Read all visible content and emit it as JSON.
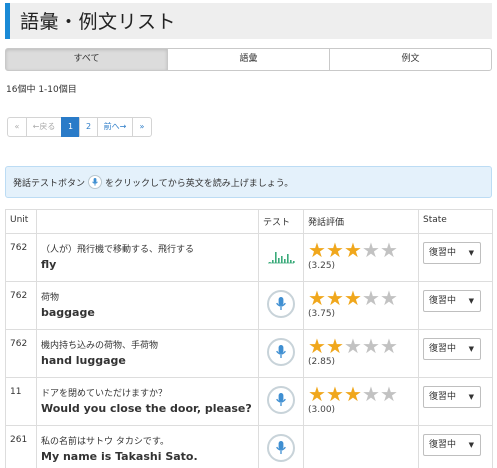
{
  "page": {
    "title": "語彙・例文リスト"
  },
  "tabs": [
    {
      "label": "すべて"
    },
    {
      "label": "語彙"
    },
    {
      "label": "例文"
    }
  ],
  "result_count": "16個中 1-10個目",
  "pagination": {
    "first": "«",
    "prev": "←戻る",
    "pages": [
      "1",
      "2"
    ],
    "current_page": "1",
    "next": "前へ→",
    "last": "»"
  },
  "notice": {
    "before": "発話テストボタン",
    "after": "をクリックしてから英文を読み上げましょう。"
  },
  "table": {
    "headers": [
      "Unit",
      "",
      "テスト",
      "発話評価",
      "State"
    ],
    "rows": [
      {
        "unit": "762",
        "jp": "（人が）飛行機で移動する、飛行する",
        "en": "fly",
        "test": "waveform-icon",
        "stars": 3,
        "score": "(3.25)",
        "state": "復習中"
      },
      {
        "unit": "762",
        "jp": "荷物",
        "en": "baggage",
        "test": "microphone-icon",
        "stars": 3,
        "score": "(3.75)",
        "state": "復習中"
      },
      {
        "unit": "762",
        "jp": "機内持ち込みの荷物、手荷物",
        "en": "hand luggage",
        "test": "microphone-icon",
        "stars": 2,
        "score": "(2.85)",
        "state": "復習中"
      },
      {
        "unit": "11",
        "jp": "ドアを閉めていただけますか？",
        "en": "Would you close the door, please?",
        "test": "microphone-icon",
        "stars": 3,
        "score": "(3.00)",
        "state": "復習中"
      },
      {
        "unit": "261",
        "jp": "私の名前はサトウ タカシです。",
        "en": "My name is Takashi Sato.",
        "test": "microphone-icon",
        "stars": 0,
        "score": "",
        "state": "復習中"
      }
    ]
  },
  "colors": {
    "accent": "#1a8ad6",
    "link": "#2a7bc8",
    "star_on": "#f0a71c",
    "star_off": "#c2c2c2",
    "notice_bg": "#e4f1fb"
  }
}
